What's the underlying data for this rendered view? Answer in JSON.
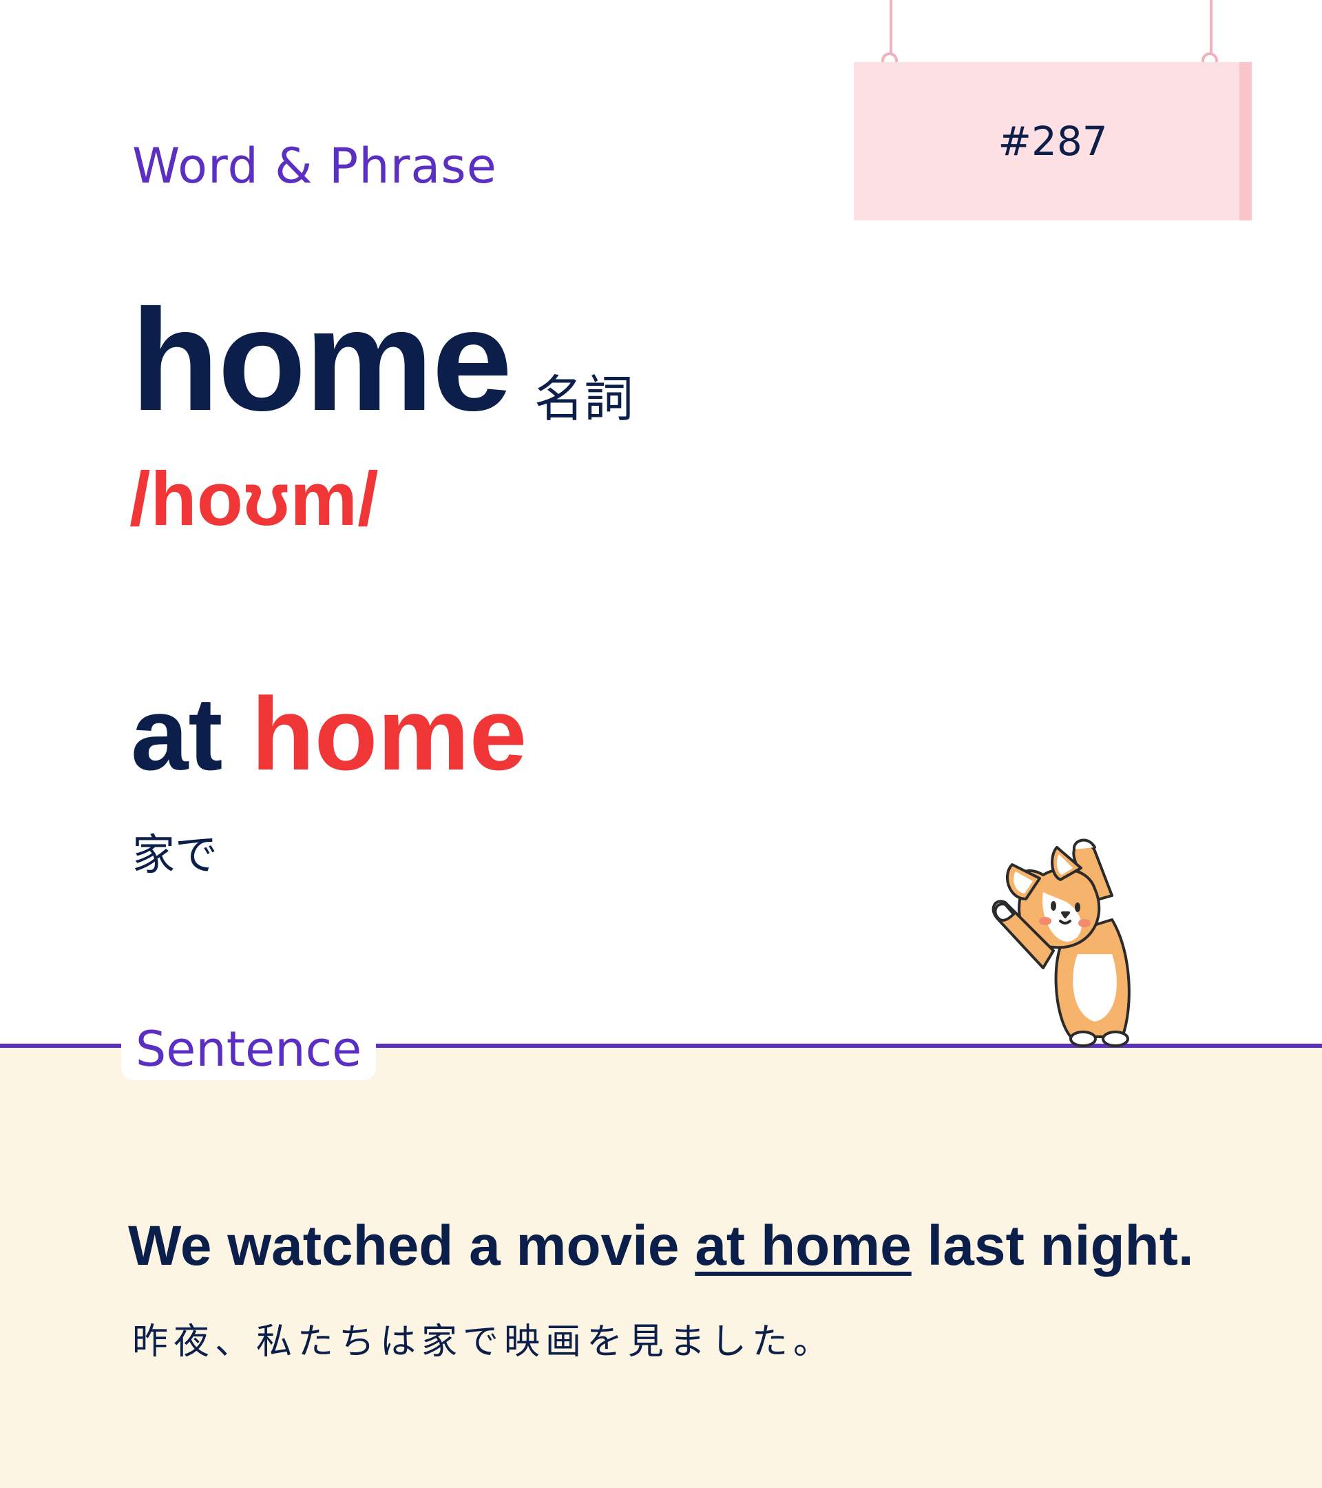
{
  "header": {
    "category": "Word & Phrase",
    "entry_number": "#287"
  },
  "word": {
    "headword": "home",
    "part_of_speech": "名詞",
    "pronunciation": "/hoʊm/"
  },
  "phrase": {
    "prefix": "at ",
    "highlight": "home",
    "translation": "家で"
  },
  "sentence_section": {
    "label": "Sentence",
    "example_before": "We watched a movie ",
    "example_highlight": "at home",
    "example_after": " last night.",
    "translation": "昨夜、私たちは家で映画を見ました。"
  },
  "colors": {
    "accent": "#5a2fc2",
    "highlight": "#f03637",
    "text": "#0c1f4a",
    "card": "#fde0e3",
    "bottom_bg": "#fcf5e3"
  },
  "icons": {
    "mascot": "corgi-mascot-icon"
  }
}
